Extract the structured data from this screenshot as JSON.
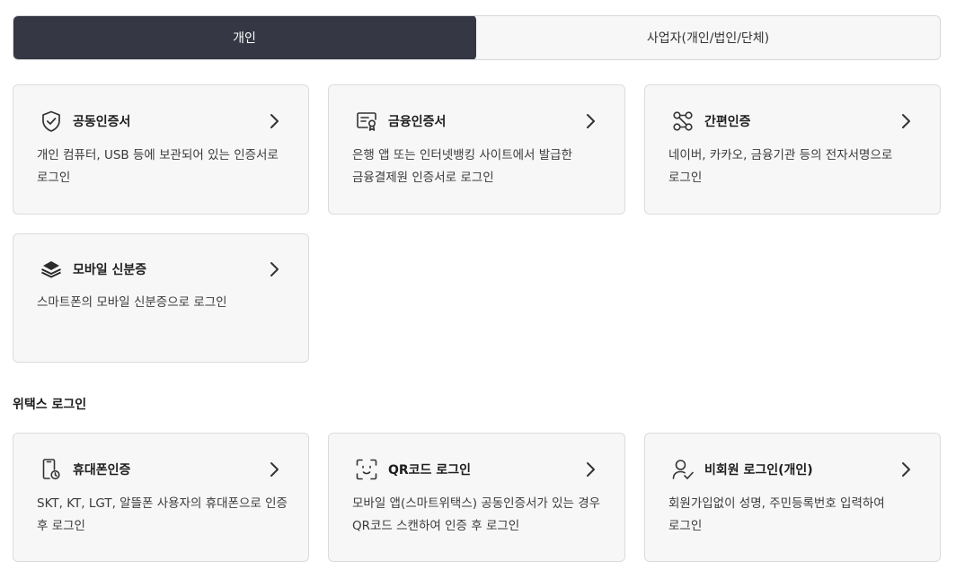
{
  "tabs": [
    {
      "label": "개인",
      "active": true
    },
    {
      "label": "사업자(개인/법인/단체)",
      "active": false
    }
  ],
  "cards": [
    {
      "icon": "shield-check-icon",
      "title": "공동인증서",
      "desc": "개인 컴퓨터, USB 등에 보관되어 있는 인증서로 로그인"
    },
    {
      "icon": "certificate-icon",
      "title": "금융인증서",
      "desc": "은행 앱 또는 인터넷뱅킹 사이트에서 발급한 금융결제원 인증서로 로그인"
    },
    {
      "icon": "simple-auth-icon",
      "title": "간편인증",
      "desc": "네이버, 카카오, 금융기관 등의 전자서명으로 로그인"
    },
    {
      "icon": "layers-icon",
      "title": "모바일 신분증",
      "desc": "스마트폰의 모바일 신분증으로 로그인"
    }
  ],
  "section": {
    "title": "위택스 로그인"
  },
  "wetax_cards": [
    {
      "icon": "mobile-phone-icon",
      "title": "휴대폰인증",
      "desc": "SKT, KT, LGT, 알뜰폰 사용자의 휴대폰으로 인증 후 로그인"
    },
    {
      "icon": "qr-scan-icon",
      "title": "QR코드 로그인",
      "desc": "모바일 앱(스마트위택스) 공동인증서가 있는 경우 QR코드 스캔하여 인증 후 로그인"
    },
    {
      "icon": "user-check-icon",
      "title": "비회원 로그인(개인)",
      "desc": "회원가입없이 성명, 주민등록번호 입력하여 로그인"
    }
  ]
}
